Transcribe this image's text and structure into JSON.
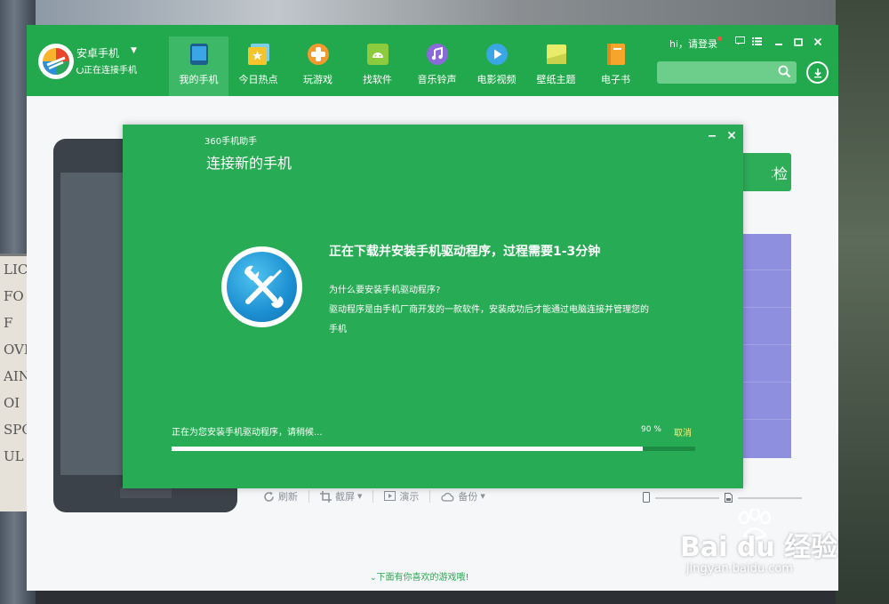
{
  "background": {
    "sign_lines": [
      "LIC",
      "FO",
      "F",
      "OVIC",
      "AIN",
      "OI",
      "SPO",
      "UL"
    ]
  },
  "app": {
    "device": {
      "name": "安卓手机",
      "status": "正在连接手机"
    },
    "nav": [
      {
        "label": "我的手机",
        "icon": "phone-icon",
        "active": true
      },
      {
        "label": "今日热点",
        "icon": "star-icon",
        "active": false
      },
      {
        "label": "玩游戏",
        "icon": "game-icon",
        "active": false
      },
      {
        "label": "找软件",
        "icon": "android-icon",
        "active": false
      },
      {
        "label": "音乐铃声",
        "icon": "music-icon",
        "active": false
      },
      {
        "label": "电影视频",
        "icon": "play-icon",
        "active": false
      },
      {
        "label": "壁纸主题",
        "icon": "wallpaper-icon",
        "active": false
      },
      {
        "label": "电子书",
        "icon": "book-icon",
        "active": false
      }
    ],
    "login_text": "hi，请登录",
    "search_placeholder": "",
    "exam_button_partial": "体检",
    "toolbar": [
      {
        "label": "刷新",
        "icon": "refresh-icon",
        "dropdown": false
      },
      {
        "label": "截屏",
        "icon": "crop-icon",
        "dropdown": true
      },
      {
        "label": "演示",
        "icon": "present-icon",
        "dropdown": false
      },
      {
        "label": "备份",
        "icon": "cloud-icon",
        "dropdown": true
      }
    ],
    "games_hint": "下面有你喜欢的游戏哦!"
  },
  "dialog": {
    "app_name": "360手机助手",
    "title": "连接新的手机",
    "heading": "正在下载并安装手机驱动程序，过程需要1-3分钟",
    "question": "为什么要安装手机驱动程序?",
    "description": "驱动程序是由手机厂商开发的一款软件，安装成功后才能通过电脑连接并管理您的手机",
    "progress_status": "正在为您安装手机驱动程序，请稍候...",
    "progress_percent": 90,
    "progress_percent_label": "90 %",
    "cancel_label": "取消"
  },
  "watermark": {
    "text": "Bai du 经验",
    "sub": "jingyan.baidu.com"
  },
  "colors": {
    "brand_green": "#23a94d",
    "dialog_green": "#27ab54",
    "cancel_yellow": "#f5f27a",
    "storage_purple": "#8e8fdf"
  }
}
